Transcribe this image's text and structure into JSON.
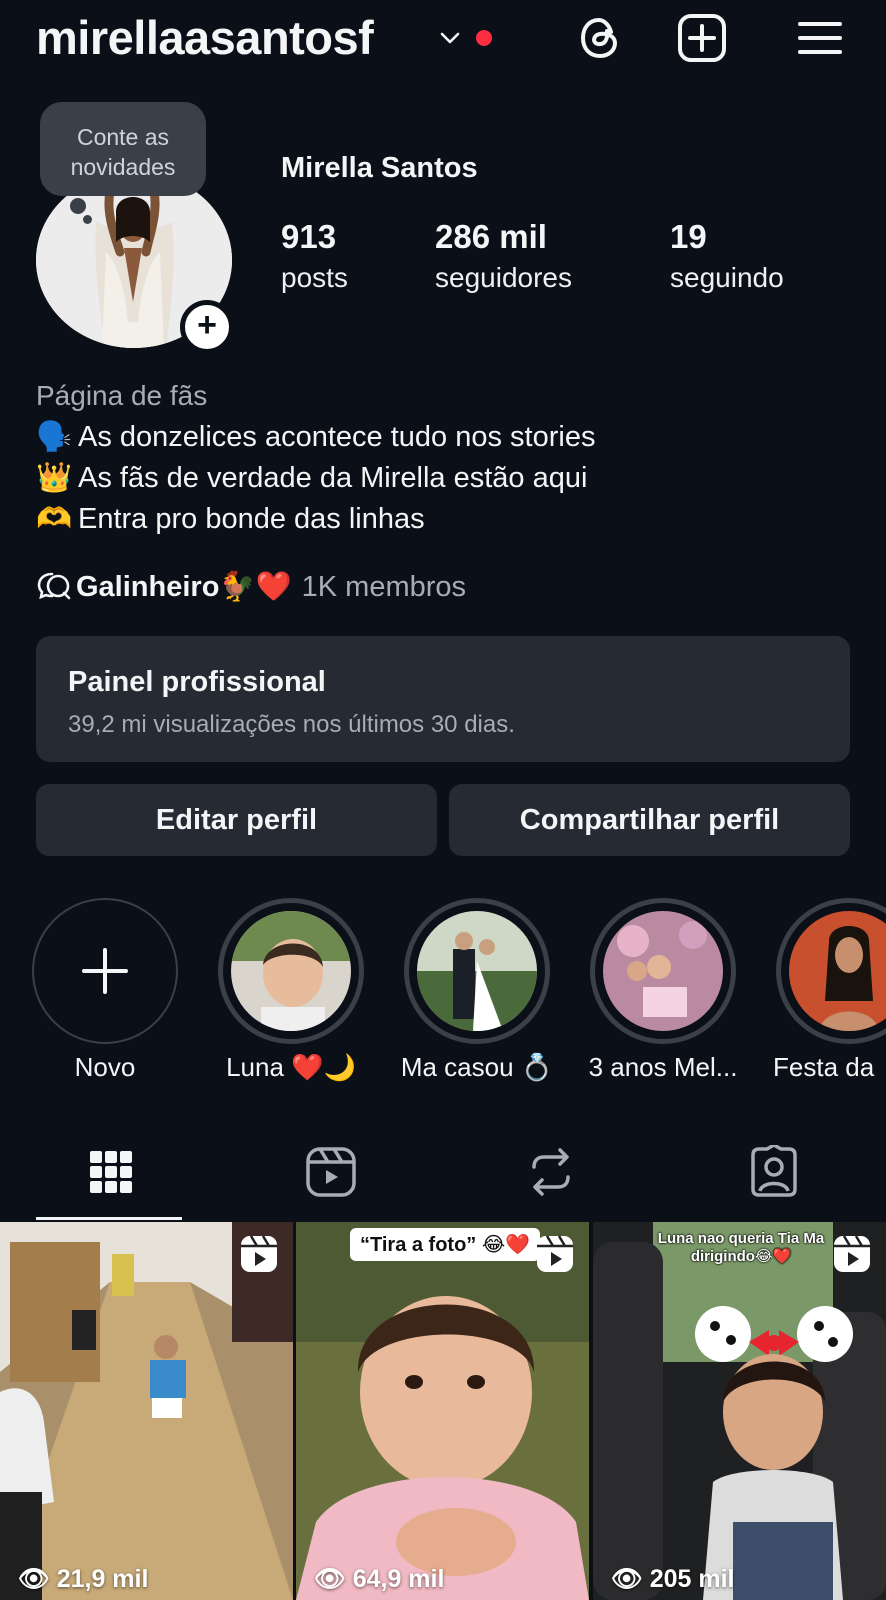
{
  "header": {
    "username": "mirellaasantosf",
    "icons": [
      "chevron-down-icon",
      "threads-icon",
      "create-icon",
      "menu-icon"
    ],
    "notification_color": "#ff2d42"
  },
  "profile": {
    "note": "Conte as novidades",
    "name": "Mirella Santos",
    "stats": [
      {
        "value": "913",
        "label": "posts"
      },
      {
        "value": "286 mil",
        "label": "seguidores"
      },
      {
        "value": "19",
        "label": "seguindo"
      }
    ]
  },
  "bio": {
    "category": "Página de fãs",
    "lines": [
      {
        "emoji": "🗣️",
        "text": "As donzelices acontece tudo nos stories"
      },
      {
        "emoji": "👑",
        "text": "As fãs de verdade da Mirella estão aqui"
      },
      {
        "emoji": "🫶",
        "text": "Entra pro bonde das linhas"
      }
    ]
  },
  "channel": {
    "name": "Galinheiro🐓❤️",
    "members": "1K membros"
  },
  "dashboard": {
    "title": "Painel profissional",
    "subtitle": "39,2 mi visualizações nos últimos 30 dias."
  },
  "buttons": {
    "edit": "Editar perfil",
    "share": "Compartilhar perfil"
  },
  "highlights": [
    {
      "label": "Novo"
    },
    {
      "label": "Luna ❤️🌙"
    },
    {
      "label": "Ma casou 💍"
    },
    {
      "label": "3 anos Mel..."
    },
    {
      "label": "Festa da"
    }
  ],
  "tabs": [
    "grid-icon",
    "reels-icon",
    "reposts-icon",
    "tagged-icon"
  ],
  "posts": [
    {
      "views": "21,9 mil",
      "caption": ""
    },
    {
      "views": "64,9 mil",
      "caption": "“Tira a foto” 😂❤️"
    },
    {
      "views": "205 mil",
      "caption": "Luna nao queria Tia Ma dirigindo😂❤️"
    }
  ]
}
